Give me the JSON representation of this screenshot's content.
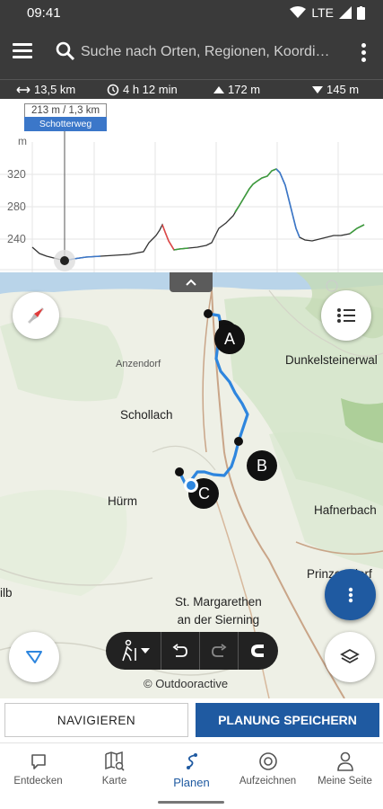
{
  "status": {
    "time": "09:41",
    "network": "LTE"
  },
  "search": {
    "placeholder": "Suche nach Orten, Regionen, Koordi…"
  },
  "stats": {
    "distance": "13,5 km",
    "duration": "4 h 12 min",
    "ascent": "172 m",
    "descent": "145 m"
  },
  "profile": {
    "tooltip_value": "213 m / 1,3 km",
    "tooltip_label": "Schotterweg",
    "y_unit": "m",
    "y_ticks": [
      "320",
      "280",
      "240"
    ],
    "colors": {
      "line": "#333333",
      "uphill_green": "#3d9b3d",
      "flat_blue": "#3b77c9",
      "steep_red": "#e04848",
      "marker": "#222222"
    }
  },
  "map": {
    "labels": {
      "dunkelsteinerwald": "Dunkelsteinerwal",
      "anzendorf": "Anzendorf",
      "schollach": "Schollach",
      "hafnerbach": "Hafnerbach",
      "hurm": "Hürm",
      "prinzersdorf": "Prinzersdorf",
      "st_margarethen_1": "St. Margarethen",
      "st_margarethen_2": "an der Sierning",
      "left_edge": "ilb"
    },
    "waypoints": [
      "A",
      "B",
      "C"
    ],
    "copyright": "© Outdooractive",
    "route_color": "#2e86de"
  },
  "actions": {
    "navigate": "NAVIGIEREN",
    "save": "PLANUNG SPEICHERN"
  },
  "nav": [
    {
      "label": "Entdecken",
      "icon": "chat-bubble-icon"
    },
    {
      "label": "Karte",
      "icon": "map-search-icon"
    },
    {
      "label": "Planen",
      "icon": "route-plan-icon"
    },
    {
      "label": "Aufzeichnen",
      "icon": "record-icon"
    },
    {
      "label": "Meine Seite",
      "icon": "profile-icon"
    }
  ],
  "active_nav": "Planen",
  "accent_color": "#1f5aa1"
}
